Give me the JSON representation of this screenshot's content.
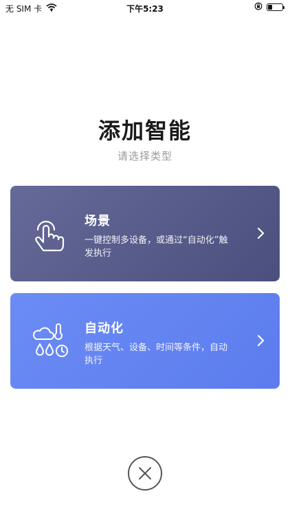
{
  "status_bar": {
    "carrier": "无 SIM 卡",
    "time": "下午5:23",
    "battery_level": 0.3
  },
  "header": {
    "title": "添加智能",
    "subtitle": "请选择类型"
  },
  "cards": [
    {
      "title": "场景",
      "description": "一键控制多设备，或通过“自动化”触发执行",
      "icon": "tap-finger-icon",
      "color": "#565a8a"
    },
    {
      "title": "自动化",
      "description": "根据天气、设备、时间等条件，自动执行",
      "icon": "weather-time-icon",
      "color": "#6585f1"
    }
  ],
  "close_icon": "close-icon"
}
